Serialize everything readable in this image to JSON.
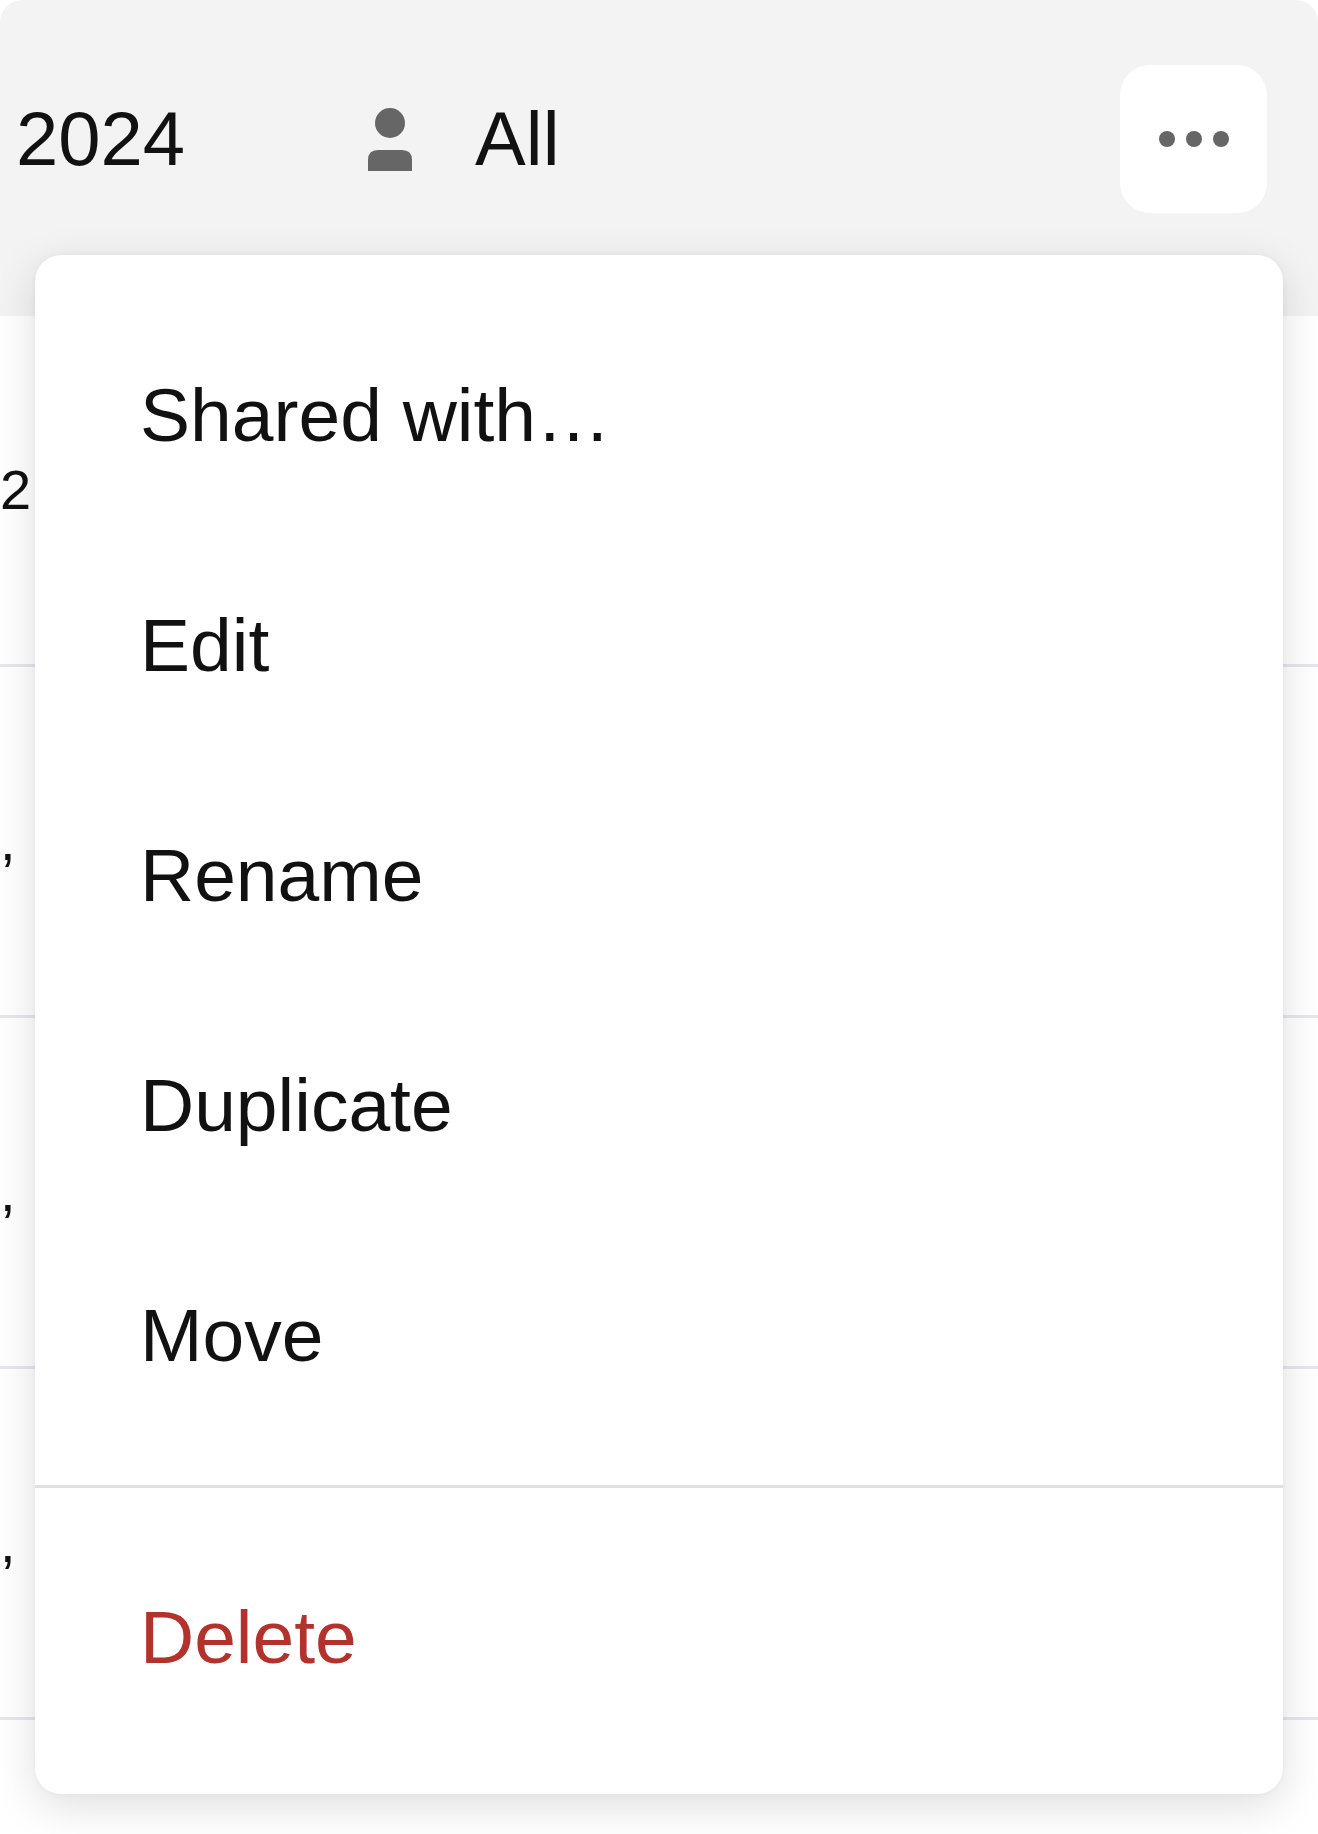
{
  "header": {
    "period": "2024",
    "person_filter": "All"
  },
  "rows": [
    {
      "column_1": "2"
    },
    {
      "column_1": ","
    },
    {
      "column_1": ","
    },
    {
      "column_1": ","
    }
  ],
  "menu": {
    "groups": [
      [
        {
          "label": "Shared with…",
          "kind": "normal"
        },
        {
          "label": "Edit",
          "kind": "normal"
        },
        {
          "label": "Rename",
          "kind": "normal"
        },
        {
          "label": "Duplicate",
          "kind": "normal"
        },
        {
          "label": "Move",
          "kind": "normal"
        }
      ],
      [
        {
          "label": "Delete",
          "kind": "danger"
        }
      ]
    ]
  }
}
